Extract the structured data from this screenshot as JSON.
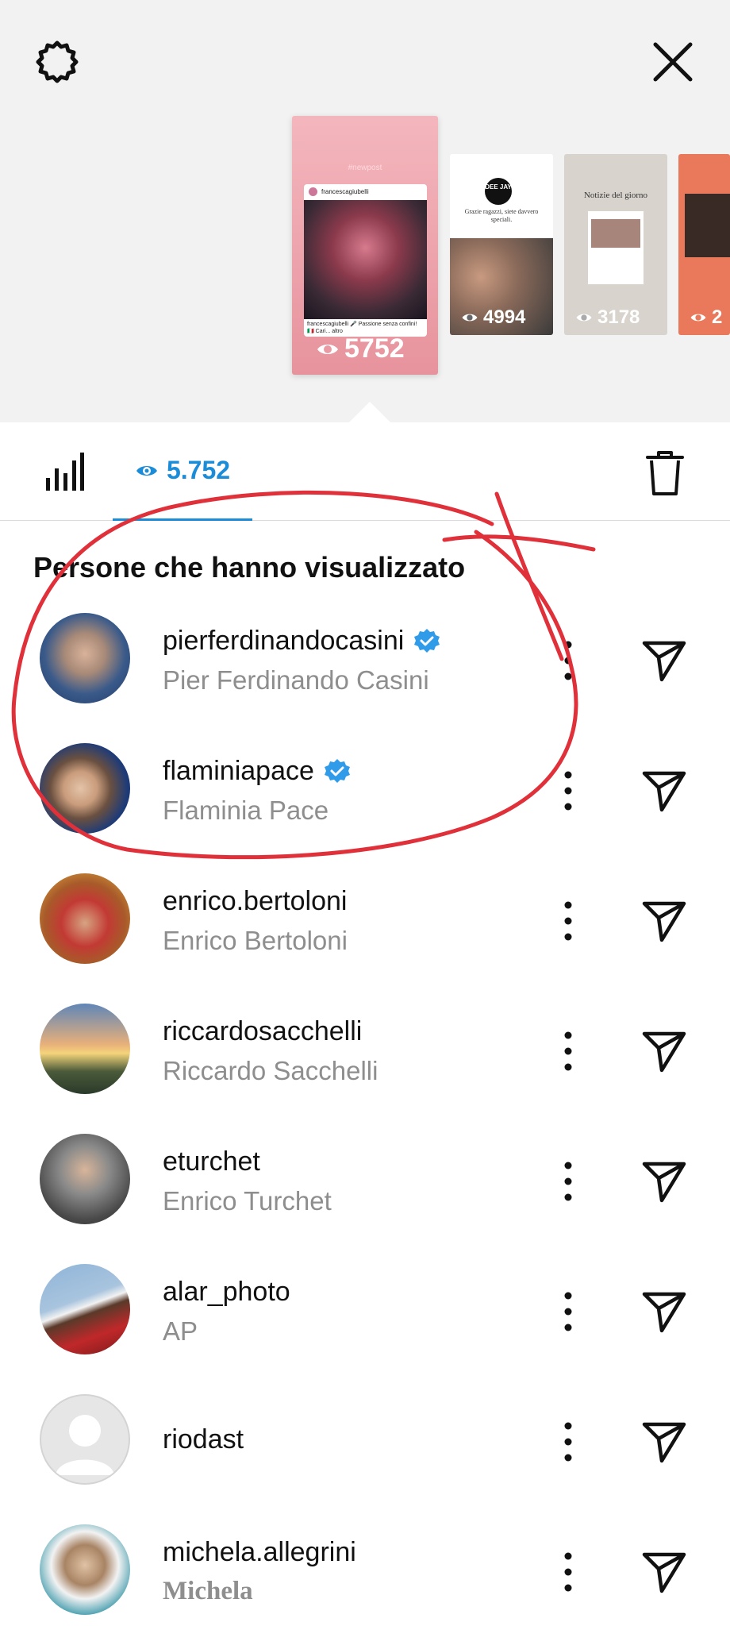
{
  "header": {
    "settings_icon": "gear-icon",
    "close_icon": "close-icon"
  },
  "stories": [
    {
      "hashtag": "#newpost",
      "post_user": "francescagiubelli",
      "post_caption": "francescagiubelli 🎤 Passione senza confini! 🇮🇹 Cari... altro",
      "views": "5752"
    },
    {
      "logo": "DEE JAY",
      "text": "Grazie ragazzi, siete davvero speciali.",
      "views": "4994"
    },
    {
      "title": "Notizie del giorno",
      "views": "3178"
    },
    {
      "views": "2"
    }
  ],
  "tabs": {
    "views_label": "5.752",
    "accent_color": "#1a8cd8"
  },
  "section_title": "Persone che hanno visualizzato",
  "viewers": [
    {
      "username": "pierferdinandocasini",
      "full_name": "Pier Ferdinando Casini",
      "verified": true
    },
    {
      "username": "flaminiapace",
      "full_name": "Flaminia Pace",
      "verified": true
    },
    {
      "username": "enrico.bertoloni",
      "full_name": "Enrico Bertoloni",
      "verified": false
    },
    {
      "username": "riccardosacchelli",
      "full_name": "Riccardo Sacchelli",
      "verified": false
    },
    {
      "username": "eturchet",
      "full_name": "Enrico Turchet",
      "verified": false
    },
    {
      "username": "alar_photo",
      "full_name": "AP",
      "verified": false
    },
    {
      "username": "riodast",
      "full_name": "",
      "verified": false
    },
    {
      "username": "michela.allegrini",
      "full_name": "Michela",
      "verified": false
    }
  ],
  "annotation_color": "#e0303a"
}
